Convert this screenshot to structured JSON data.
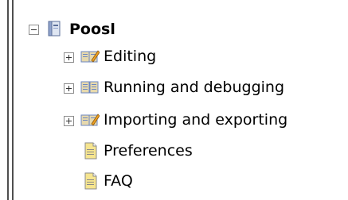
{
  "tree": {
    "root": {
      "label": "Poosl",
      "expanded": true,
      "icon": "project-book-icon"
    },
    "items": [
      {
        "label": "Editing",
        "expanded": false,
        "icon": "book-pencil-icon"
      },
      {
        "label": "Running and debugging",
        "expanded": false,
        "icon": "book-open-icon"
      },
      {
        "label": "Importing and exporting",
        "expanded": false,
        "icon": "book-pencil-icon"
      },
      {
        "label": "Preferences",
        "icon": "page-icon"
      },
      {
        "label": "FAQ",
        "icon": "page-icon"
      }
    ]
  },
  "colors": {
    "text": "#000000",
    "toggle_border": "#8c8c8c",
    "sidebar_bar": "#4f4f4f",
    "book_blue": "#6c87c2",
    "book_tan": "#e7d9ad",
    "page_yellow": "#f6e58f"
  }
}
